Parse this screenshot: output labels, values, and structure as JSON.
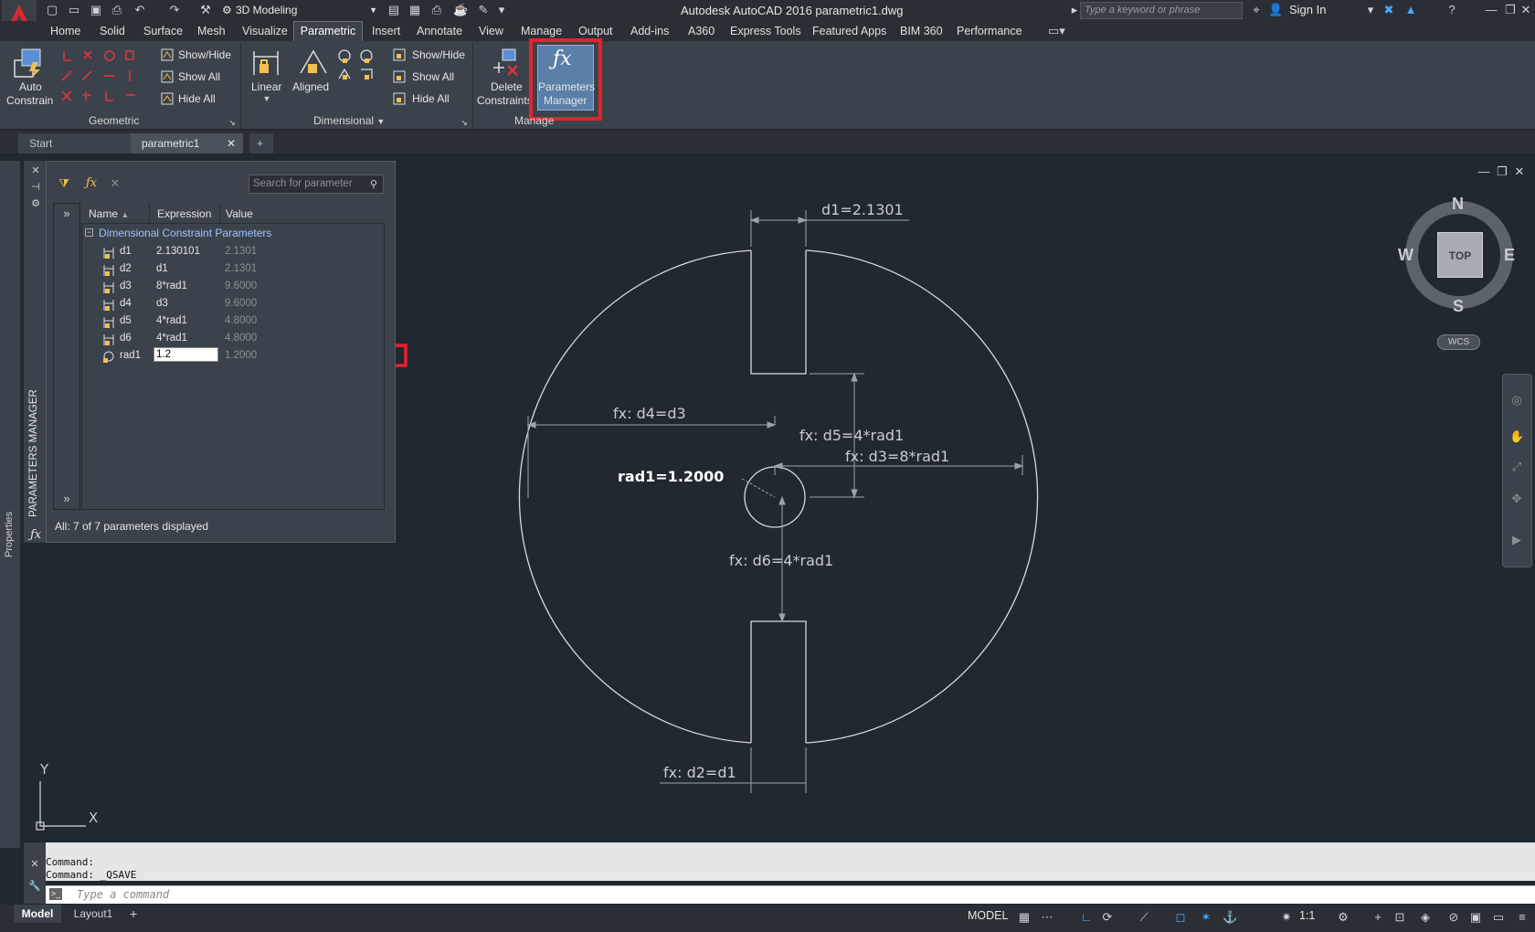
{
  "titlebar": {
    "workspace": "3D Modeling",
    "app_title": "Autodesk AutoCAD 2016    parametric1.dwg",
    "search_placeholder": "Type a keyword or phrase",
    "sign_in": "Sign In"
  },
  "ribbon_tabs": [
    "Home",
    "Solid",
    "Surface",
    "Mesh",
    "Visualize",
    "Parametric",
    "Insert",
    "Annotate",
    "View",
    "Manage",
    "Output",
    "Add-ins",
    "A360",
    "Express Tools",
    "Featured Apps",
    "BIM 360",
    "Performance"
  ],
  "ribbon": {
    "auto_constrain_1": "Auto",
    "auto_constrain_2": "Constrain",
    "geo_show_hide": "Show/Hide",
    "geo_show_all": "Show All",
    "geo_hide_all": "Hide All",
    "linear": "Linear",
    "aligned": "Aligned",
    "dim_show_hide": "Show/Hide",
    "dim_show_all": "Show All",
    "dim_hide_all": "Hide All",
    "delete_1": "Delete",
    "delete_2": "Constraints",
    "pm_1": "Parameters",
    "pm_2": "Manager",
    "panel_geometric": "Geometric",
    "panel_dimensional": "Dimensional",
    "panel_manage": "Manage"
  },
  "file_tabs": {
    "start": "Start",
    "file": "parametric1"
  },
  "palette": {
    "title": "PARAMETERS MANAGER",
    "search_placeholder": "Search for parameter",
    "col_name": "Name",
    "col_expression": "Expression",
    "col_value": "Value",
    "group": "Dimensional Constraint Parameters",
    "params": [
      {
        "name": "d1",
        "expression": "2.130101",
        "value": "2.1301"
      },
      {
        "name": "d2",
        "expression": "d1",
        "value": "2.1301"
      },
      {
        "name": "d3",
        "expression": "8*rad1",
        "value": "9.6000"
      },
      {
        "name": "d4",
        "expression": "d3",
        "value": "9.6000"
      },
      {
        "name": "d5",
        "expression": "4*rad1",
        "value": "4.8000"
      },
      {
        "name": "d6",
        "expression": "4*rad1",
        "value": "4.8000"
      },
      {
        "name": "rad1",
        "expression": "1.2",
        "value": "1.2000"
      }
    ],
    "status": "All: 7 of 7 parameters displayed"
  },
  "left_strip_label": "Properties",
  "drawing": {
    "d1": "d1=2.1301",
    "d2": "fx: d2=d1",
    "d3": "fx: d3=8*rad1",
    "d4": "fx: d4=d3",
    "d5": "fx: d5=4*rad1",
    "d6": "fx: d6=4*rad1",
    "rad1": "rad1=1.2000",
    "ucs_x": "X",
    "ucs_y": "Y"
  },
  "viewcube": {
    "top": "TOP",
    "n": "N",
    "s": "S",
    "e": "E",
    "w": "W",
    "wcs": "WCS"
  },
  "command": {
    "line1": "Command:",
    "line2": "Command: _QSAVE",
    "placeholder": "Type a command"
  },
  "statusbar": {
    "model_tab": "Model",
    "layout_tab": "Layout1",
    "model": "MODEL",
    "scale": "1:1"
  },
  "colors": {
    "background": "#212830",
    "highlight": "#e8212a",
    "constraint_red": "#d9363e"
  }
}
